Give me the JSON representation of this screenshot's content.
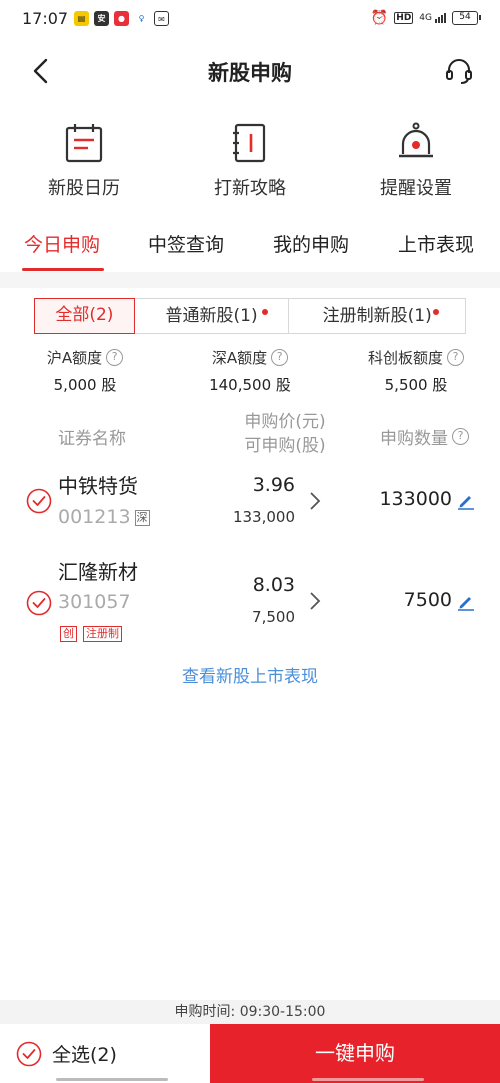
{
  "status": {
    "time": "17:07",
    "network": "4G",
    "hd": "HD",
    "battery": "54"
  },
  "header": {
    "title": "新股申购"
  },
  "quick": [
    {
      "label": "新股日历",
      "icon": "calendar-icon"
    },
    {
      "label": "打新攻略",
      "icon": "notebook-icon"
    },
    {
      "label": "提醒设置",
      "icon": "bell-icon"
    }
  ],
  "tabs": [
    {
      "label": "今日申购",
      "active": true
    },
    {
      "label": "中签查询"
    },
    {
      "label": "我的申购"
    },
    {
      "label": "上市表现"
    }
  ],
  "filters": [
    {
      "label": "全部(2)",
      "active": true
    },
    {
      "label": "普通新股(1)"
    },
    {
      "label": "注册制新股(1)"
    }
  ],
  "quotas": [
    {
      "label": "沪A额度",
      "value": "5,000 股"
    },
    {
      "label": "深A额度",
      "value": "140,500 股"
    },
    {
      "label": "科创板额度",
      "value": "5,500 股"
    }
  ],
  "columns": {
    "name": "证券名称",
    "price_line1": "申购价(元)",
    "price_line2": "可申购(股)",
    "qty": "申购数量"
  },
  "rows": [
    {
      "name": "中铁特货",
      "code": "001213",
      "market": "深",
      "price": "3.96",
      "available": "133,000",
      "qty": "133000",
      "badges": []
    },
    {
      "name": "汇隆新材",
      "code": "301057",
      "market": "",
      "price": "8.03",
      "available": "7,500",
      "qty": "7500",
      "badges": [
        "创",
        "注册制"
      ]
    }
  ],
  "link": "查看新股上市表现",
  "footer": {
    "time_text": "申购时间: 09:30-15:00",
    "select_all": "全选(2)",
    "submit": "一键申购"
  },
  "colors": {
    "accent": "#e22c2c",
    "link": "#4a8fd8",
    "submit_bg": "#e8222a"
  }
}
